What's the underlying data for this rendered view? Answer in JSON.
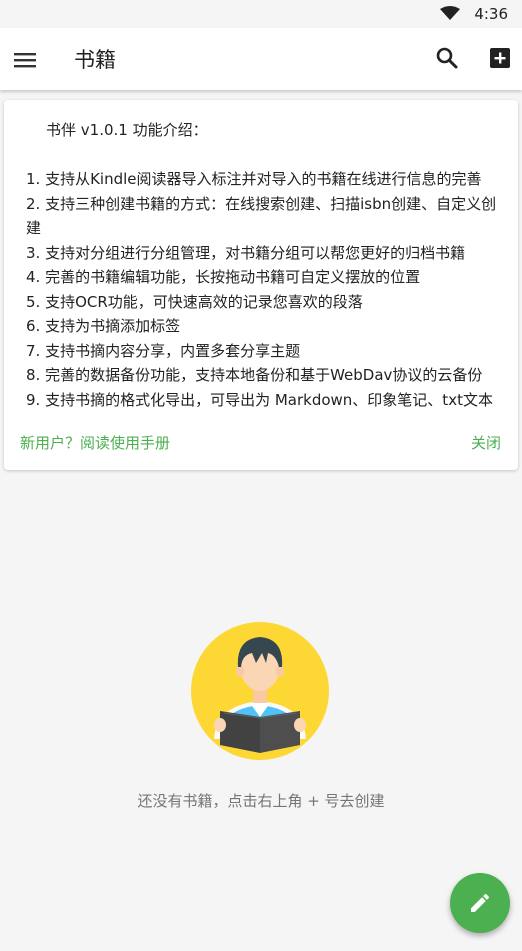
{
  "status_bar": {
    "time": "4:36",
    "wifi_icon": "wifi-icon"
  },
  "toolbar": {
    "title": "书籍",
    "menu_icon": "menu-icon",
    "search_icon": "search-icon",
    "add_icon": "add-box-icon"
  },
  "intro_card": {
    "heading": "书伴 v1.0.1 功能介绍：",
    "items": [
      "1. 支持从Kindle阅读器导入标注并对导入的书籍在线进行信息的完善",
      "2. 支持三种创建书籍的方式：在线搜索创建、扫描isbn创建、自定义创建",
      "3. 支持对分组进行分组管理，对书籍分组可以帮您更好的归档书籍",
      "4. 完善的书籍编辑功能，长按拖动书籍可自定义摆放的位置",
      "5. 支持OCR功能，可快速高效的记录您喜欢的段落",
      "6. 支持为书摘添加标签",
      "7. 支持书摘内容分享，内置多套分享主题",
      "8. 完善的数据备份功能，支持本地备份和基于WebDav协议的云备份",
      "9. 支持书摘的格式化导出，可导出为 Markdown、印象笔记、txt文本"
    ],
    "manual_link": "新用户？阅读使用手册",
    "close": "关闭"
  },
  "empty_state": {
    "illustration": "reading-person-illustration",
    "message": "还没有书籍，点击右上角 + 号去创建"
  },
  "fab": {
    "icon": "edit-pencil-icon"
  },
  "colors": {
    "accent": "#4caf50",
    "background": "#f5f5f5",
    "illustration_circle": "#fdd835",
    "book": "#424242"
  }
}
